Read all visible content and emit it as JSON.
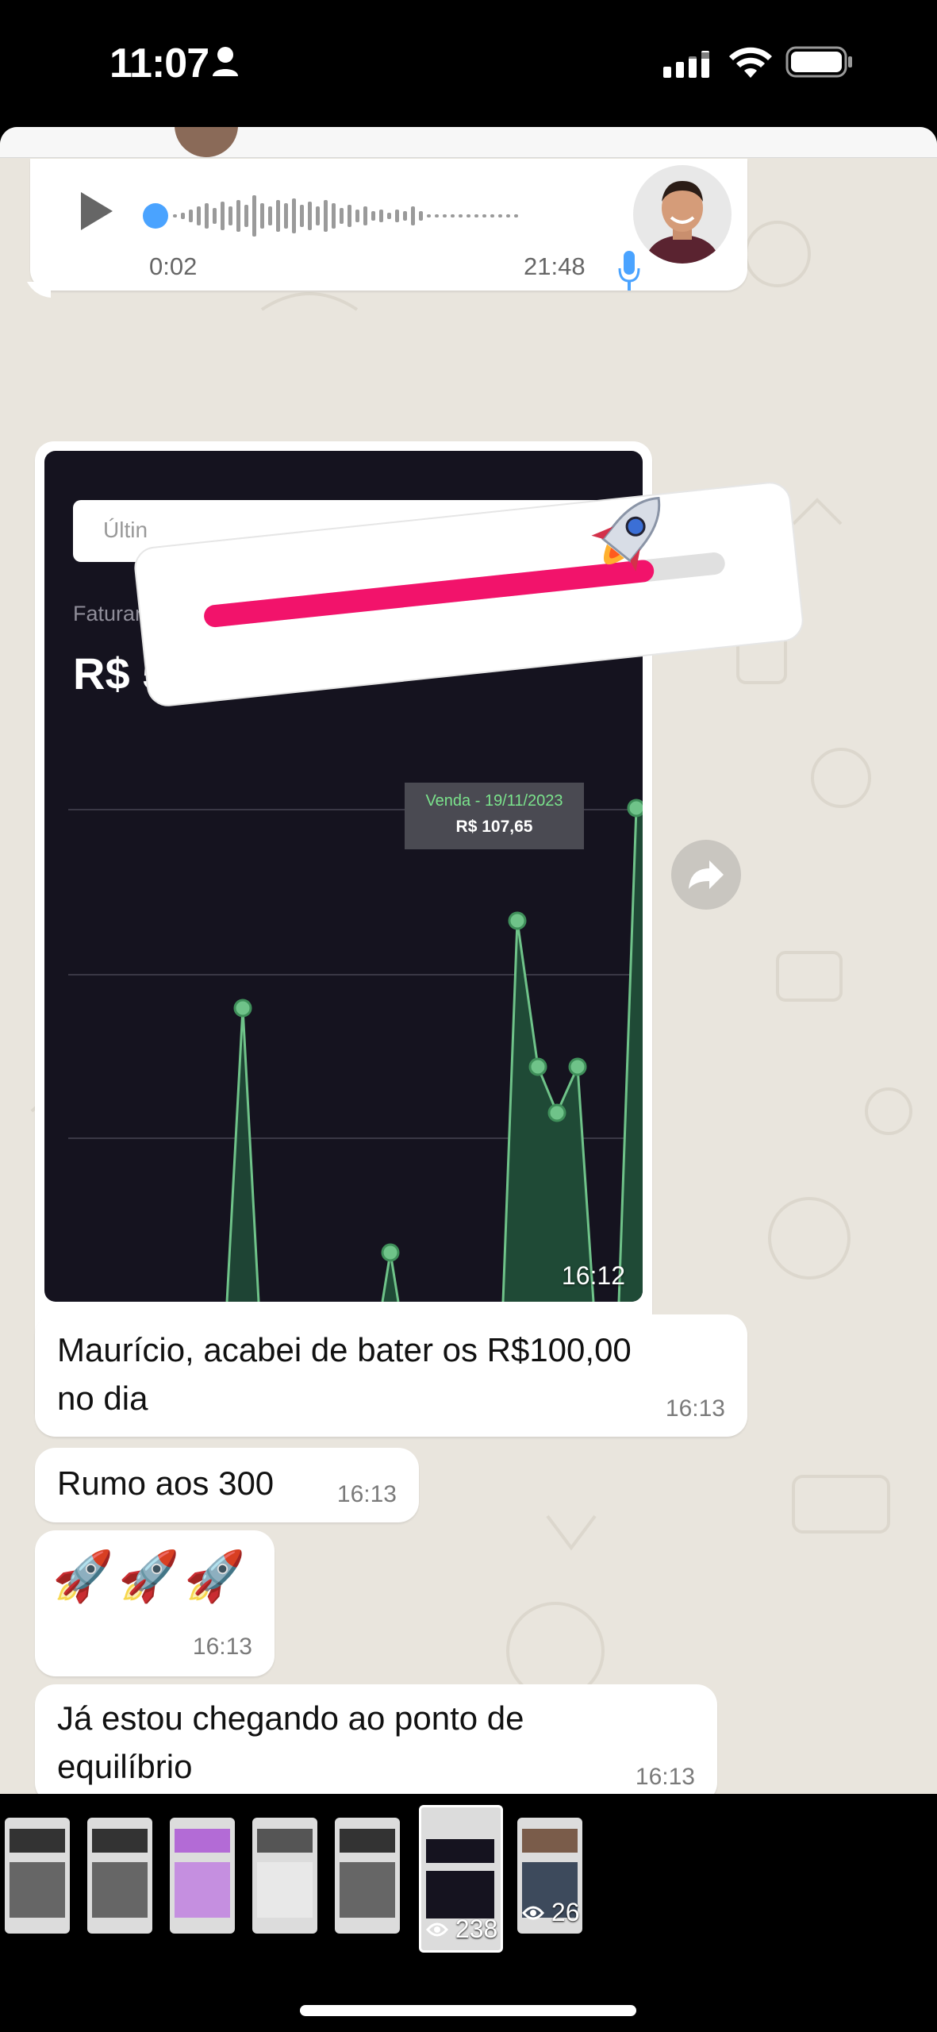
{
  "status_bar": {
    "time": "11:07"
  },
  "audio_message": {
    "elapsed": "0:02",
    "time": "21:48"
  },
  "image_message": {
    "input_text": "Últin",
    "label": "Faturamento Total",
    "total": "R$ 562,45",
    "tooltip_title": "Venda - 19/11/2023",
    "tooltip_value": "R$ 107,65",
    "time": "16:12"
  },
  "messages": [
    {
      "text_line1": "Maurício, acabei de bater os R$100,00",
      "text_line2": "no dia",
      "time": "16:13"
    },
    {
      "text": "Rumo aos 300",
      "time": "16:13"
    },
    {
      "text": "🚀🚀🚀",
      "time": "16:13"
    },
    {
      "text_line1": "Já estou chegando ao ponto de",
      "text_line2": "equilíbrio",
      "time": "16:13"
    }
  ],
  "thumbnails": {
    "selected_views": "238",
    "next_views": "26"
  },
  "colors": {
    "chat_bg": "#e9e5dd",
    "progress": "#f2136b",
    "chart_bg": "#15131f",
    "chart_line": "#6fc389"
  }
}
